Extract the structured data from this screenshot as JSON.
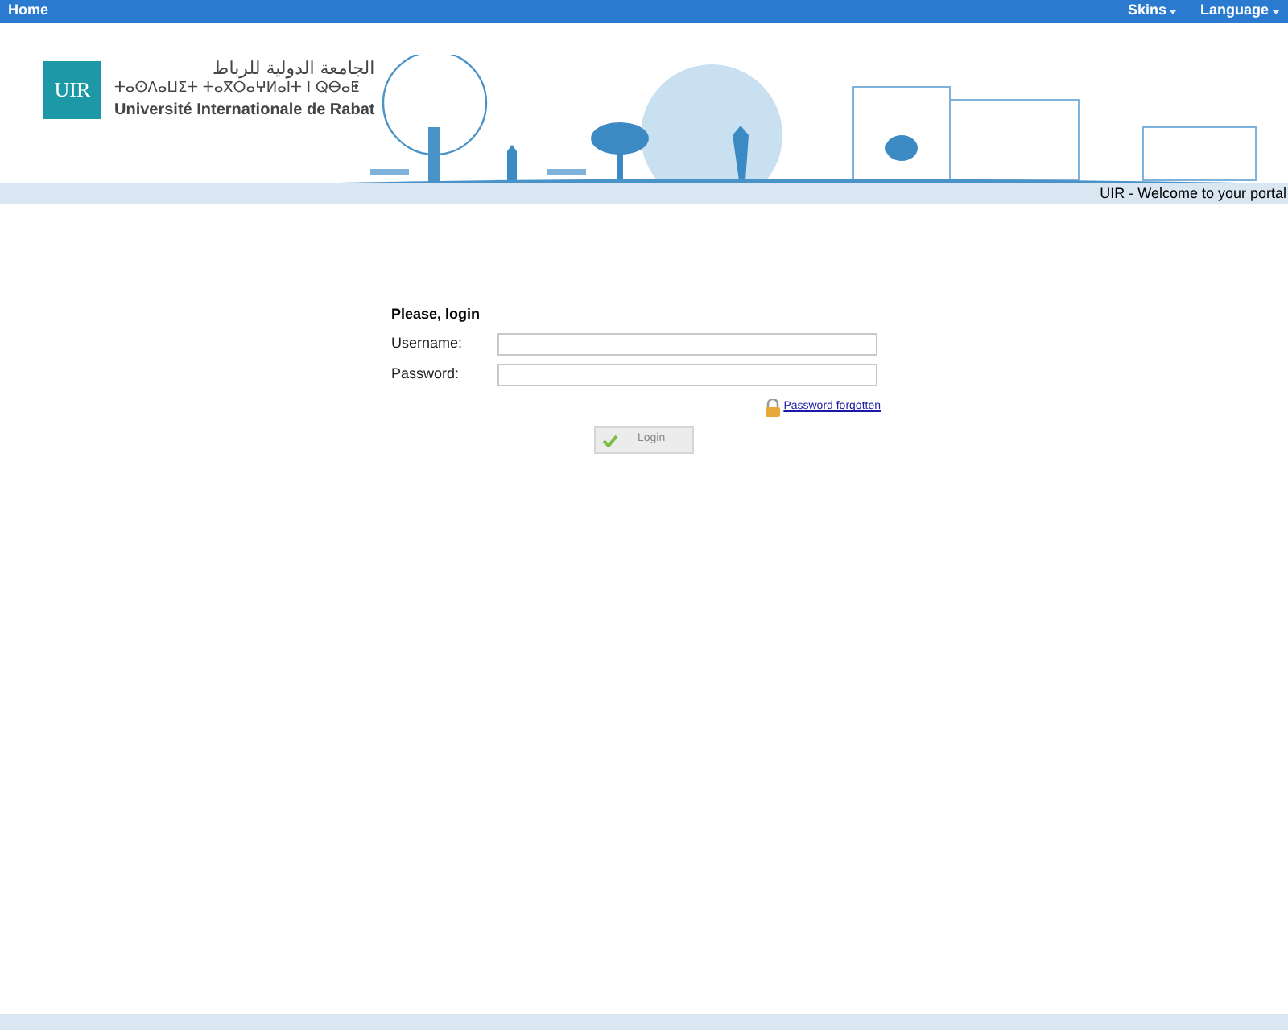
{
  "top_bar": {
    "home": "Home",
    "menus": [
      {
        "label": "Skins"
      },
      {
        "label": "Language"
      }
    ]
  },
  "logo": {
    "mark": "UIR",
    "arabic_name": "الجامعة الدولية للرباط",
    "tifinagh_name": "ⵜⴰⵙⴷⴰⵡⵉⵜ ⵜⴰⴳⵔⴰⵖⵍⴰⵏⵜ ⵏ ⵕⴱⴰⵟ",
    "name": "Université Internationale de Rabat"
  },
  "welcome": "UIR - Welcome to your portal",
  "login": {
    "title": "Please, login",
    "fields": [
      {
        "label": "Username:"
      },
      {
        "label": "Password:"
      }
    ],
    "forgot_link": "Password forgotten",
    "button": "Login"
  }
}
